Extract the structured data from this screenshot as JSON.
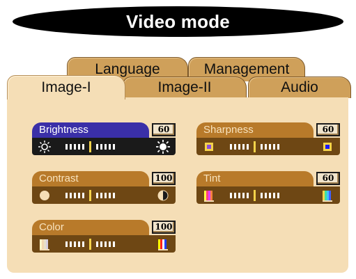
{
  "window": {
    "title": "Video mode"
  },
  "tabs": {
    "language": "Language",
    "management": "Management",
    "image1": "Image-I",
    "image2": "Image-II",
    "audio": "Audio"
  },
  "active_tab": "Image-I",
  "controls": {
    "brightness": {
      "label": "Brightness",
      "value": "60",
      "left_icon": "sun-small-icon",
      "right_icon": "sun-large-icon",
      "selected": true
    },
    "contrast": {
      "label": "Contrast",
      "value": "100",
      "left_icon": "circle-filled-icon",
      "right_icon": "circle-half-icon"
    },
    "color": {
      "label": "Color",
      "value": "100",
      "left_icon": "color-bars-pale-icon",
      "right_icon": "color-bars-vivid-icon"
    },
    "sharpness": {
      "label": "Sharpness",
      "value": "60",
      "left_icon": "square-soft-icon",
      "right_icon": "square-sharp-icon"
    },
    "tint": {
      "label": "Tint",
      "value": "60",
      "left_icon": "color-bars-warm-icon",
      "right_icon": "color-bars-cool-icon"
    }
  },
  "colors": {
    "panel": "#f5deb6",
    "tab": "#cfa05a",
    "control_header": "#b87a2a",
    "control_header_selected": "#3a2fa8",
    "track": "#6e4714",
    "track_selected": "#1a1a1a",
    "slider_knob": "#f5d34a"
  }
}
